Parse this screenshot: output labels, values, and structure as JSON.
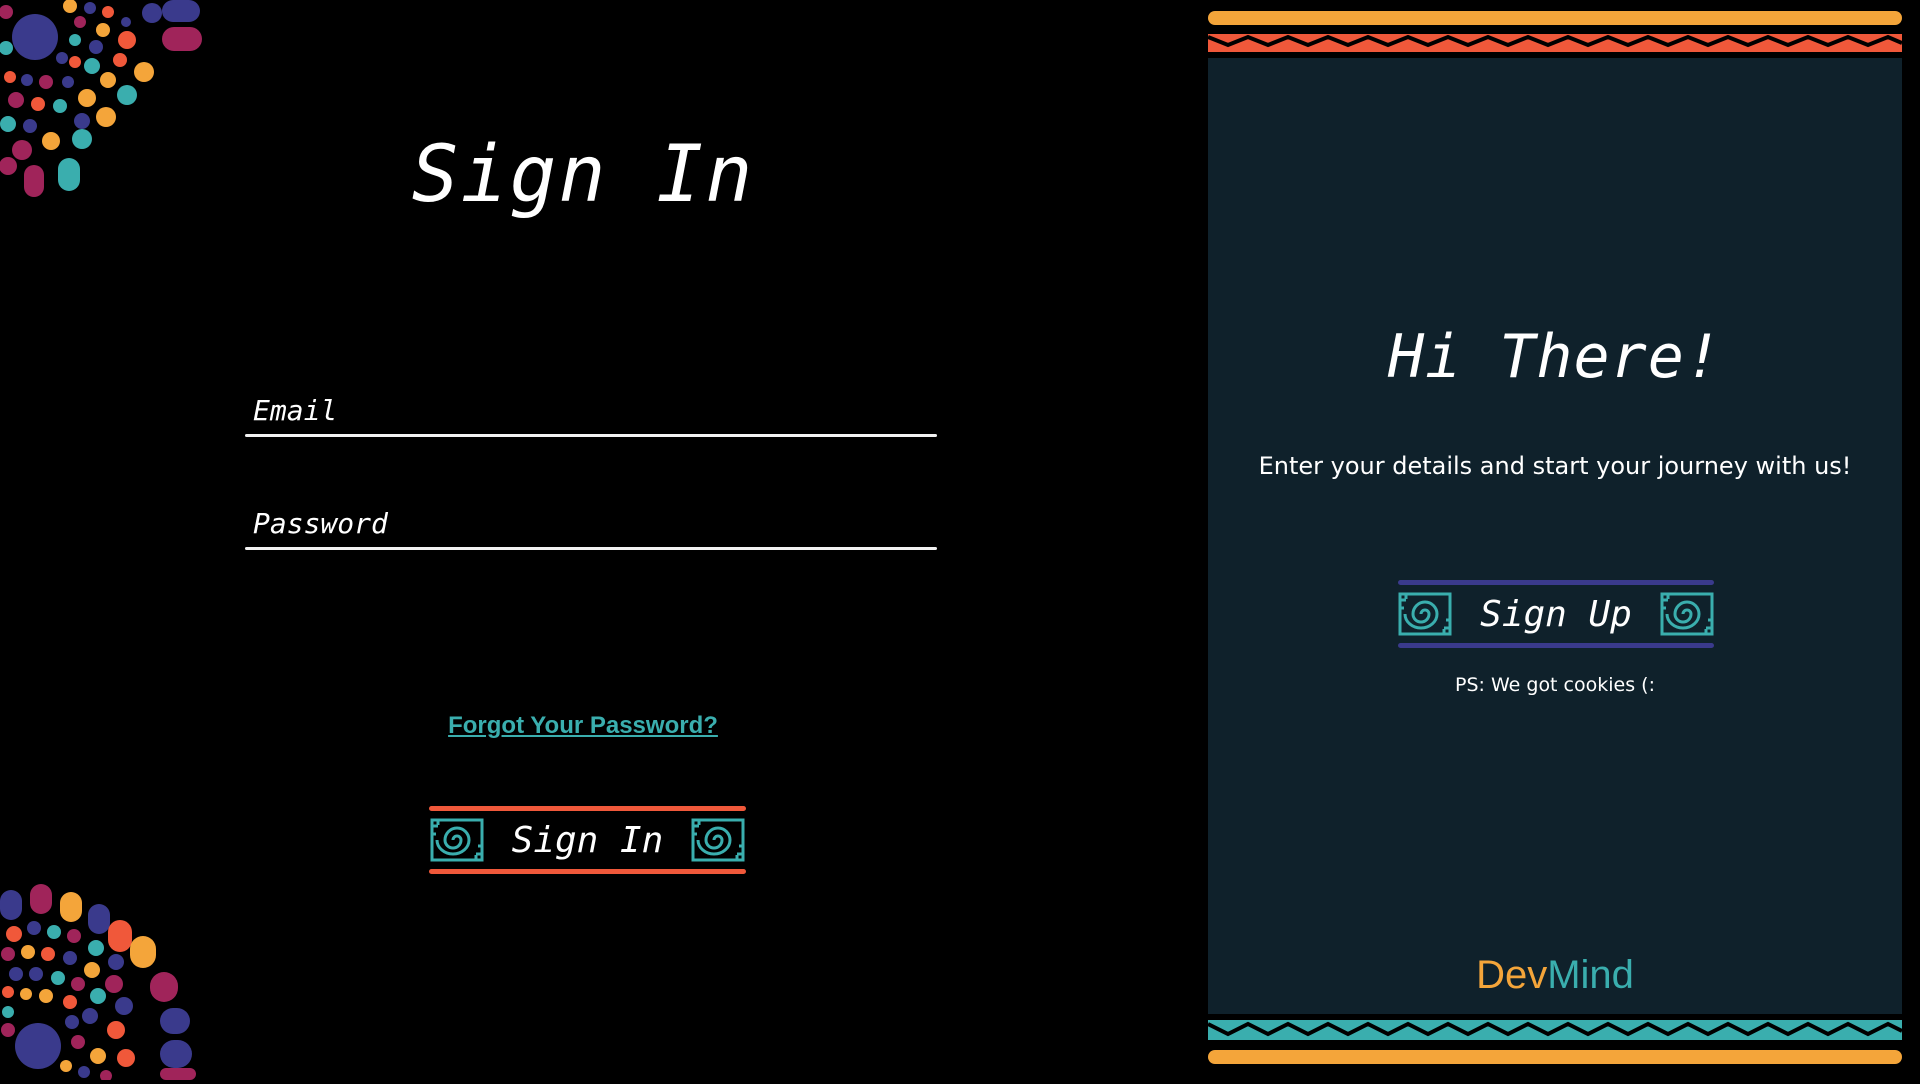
{
  "signin": {
    "title": "Sign In",
    "email_placeholder": "Email",
    "password_placeholder": "Password",
    "forgot_link": "Forgot Your Password?",
    "button_label": "Sign In"
  },
  "welcome": {
    "title": "Hi There!",
    "subtitle": "Enter your details and start your journey with us!",
    "button_label": "Sign Up",
    "note": "PS: We got cookies (:"
  },
  "brand": {
    "part1": "Dev",
    "part2": "Mind"
  },
  "colors": {
    "background": "#000000",
    "panel": "#0f212b",
    "accent_teal": "#3aaeae",
    "accent_orange": "#f4a53a",
    "accent_red": "#f0583a",
    "accent_navy": "#3a3a8c"
  },
  "icons": {
    "button_ornament": "spiral-glyph-icon",
    "decor": "dots-cluster"
  }
}
